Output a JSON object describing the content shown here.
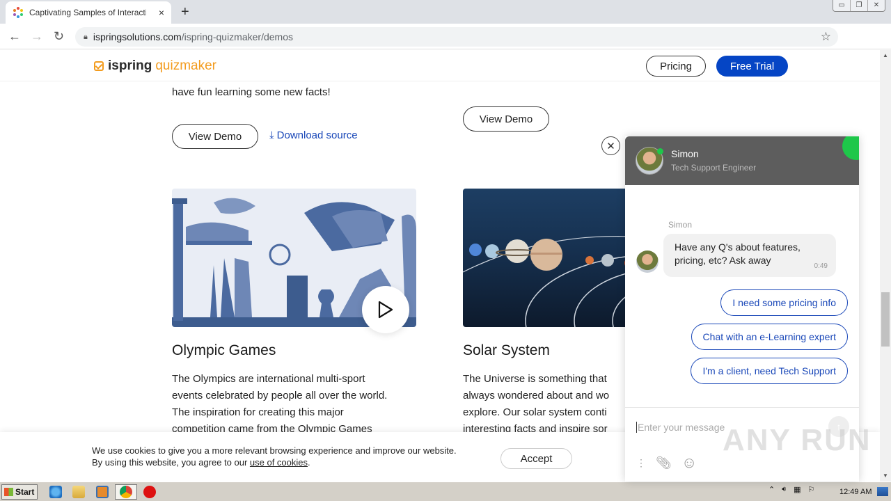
{
  "browser": {
    "tab_title": "Captivating Samples of Interactive Quizzes",
    "tab_close_icon": "×",
    "new_tab_icon": "+",
    "url_domain": "ispringsolutions.com",
    "url_path": "/ispring-quizmaker/demos",
    "window_controls": [
      "▭",
      "❐",
      "✕"
    ]
  },
  "header": {
    "logo_part1": "ispring",
    "logo_part2": "quizmaker",
    "pricing_label": "Pricing",
    "free_trial_label": "Free Trial"
  },
  "content": {
    "prev_card_tail": "have fun learning some new facts!",
    "view_demo_label": "View Demo",
    "download_label": "Download source",
    "cards": [
      {
        "title": "Olympic Games",
        "lines": [
          "The Olympics are international multi-sport",
          "events celebrated by people all over the world.",
          "The inspiration for creating this major",
          "competition came from the Olympic Games"
        ]
      },
      {
        "title": "Solar System",
        "lines": [
          "The Universe is something that",
          "always wondered about and wo",
          "explore. Our solar system conti",
          "interesting facts and inspire sor"
        ]
      }
    ]
  },
  "cookie": {
    "line1": "We use cookies to give you a more relevant browsing experience and improve our website.",
    "line2_prefix": "By using this website, you agree to our ",
    "link": "use of cookies",
    "line2_suffix": ".",
    "accept_label": "Accept"
  },
  "chat": {
    "agent_name": "Simon",
    "agent_role": "Tech Support Engineer",
    "sender": "Simon",
    "message": "Have any Q's about features, pricing, etc? Ask away",
    "time": "0:49",
    "quick_replies": [
      "I need some pricing info",
      "Chat with an e-Learning expert",
      "I'm a client, need Tech Support"
    ],
    "input_placeholder": "Enter your message",
    "accent": "#1ec74a",
    "link_color": "#1947b8"
  },
  "watermark": "ANY RUN",
  "taskbar": {
    "start_label": "Start",
    "clock": "12:49 AM"
  }
}
